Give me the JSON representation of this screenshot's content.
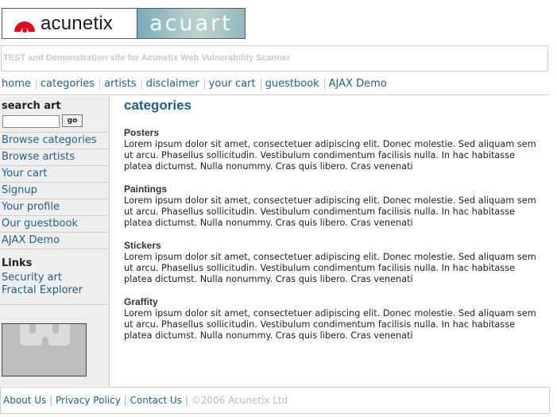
{
  "logo": {
    "brand": "acunetix",
    "product": "acuart"
  },
  "tagline": "TEST and Demonstration site for Acunetix Web Vulnerability Scanner",
  "topnav": [
    "home",
    "categories",
    "artists",
    "disclaimer",
    "your cart",
    "guestbook",
    "AJAX Demo"
  ],
  "sidebar": {
    "search_title": "search art",
    "search_value": "",
    "go_label": "go",
    "menu": [
      "Browse categories",
      "Browse artists",
      "Your cart",
      "Signup",
      "Your profile",
      "Our guestbook",
      "AJAX Demo"
    ],
    "links_title": "Links",
    "links": [
      "Security art",
      "Fractal Explorer"
    ]
  },
  "main": {
    "title": "categories",
    "categories": [
      {
        "name": "Posters",
        "desc": "Lorem ipsum dolor sit amet, consectetuer adipiscing elit. Donec molestie. Sed aliquam sem ut arcu. Phasellus sollicitudin. Vestibulum condimentum facilisis nulla. In hac habitasse platea dictumst. Nulla nonummy. Cras quis libero. Cras venenati"
      },
      {
        "name": "Paintings",
        "desc": "Lorem ipsum dolor sit amet, consectetuer adipiscing elit. Donec molestie. Sed aliquam sem ut arcu. Phasellus sollicitudin. Vestibulum condimentum facilisis nulla. In hac habitasse platea dictumst. Nulla nonummy. Cras quis libero. Cras venenati"
      },
      {
        "name": "Stickers",
        "desc": "Lorem ipsum dolor sit amet, consectetuer adipiscing elit. Donec molestie. Sed aliquam sem ut arcu. Phasellus sollicitudin. Vestibulum condimentum facilisis nulla. In hac habitasse platea dictumst. Nulla nonummy. Cras quis libero. Cras venenati"
      },
      {
        "name": "Graffity",
        "desc": "Lorem ipsum dolor sit amet, consectetuer adipiscing elit. Donec molestie. Sed aliquam sem ut arcu. Phasellus sollicitudin. Vestibulum condimentum facilisis nulla. In hac habitasse platea dictumst. Nulla nonummy. Cras quis libero. Cras venenati"
      }
    ]
  },
  "footer": {
    "links": [
      "About Us",
      "Privacy Policy",
      "Contact Us"
    ],
    "copyright": "©2006 Acunetix Ltd"
  },
  "colors": {
    "link": "#236089",
    "sidebar_bg": "#eeeeee",
    "border": "#cccccc"
  },
  "icons": {
    "brand_mark": "acunetix-logo-icon",
    "sidebar_image": "puzzle-piece-icon"
  }
}
